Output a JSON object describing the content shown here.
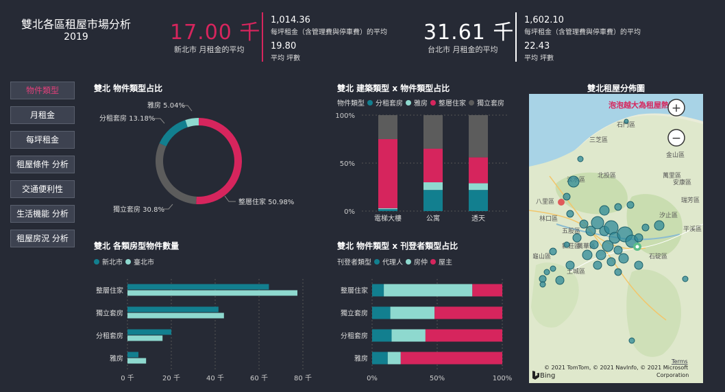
{
  "header": {
    "title": "雙北各區租屋市場分析",
    "year": "2019"
  },
  "kpis": {
    "ntpc": {
      "big": "17.00 千",
      "big_label": "新北市  月租金的平均",
      "v1": "1,014.36",
      "l1": "每坪租金（含管理費與停車費）的平均",
      "v2": "19.80",
      "l2": "平均 坪數"
    },
    "tpe": {
      "big": "31.61 千",
      "big_label": "台北市  月租金的平均",
      "v1": "1,602.10",
      "l1": "每坪租金（含管理費與停車費）的平均",
      "v2": "22.43",
      "l2": "平均 坪數"
    }
  },
  "colors": {
    "accent": "#d6255d",
    "teal": "#127f8f",
    "aqua": "#8ed9cf",
    "gray": "#5c5c5c",
    "pink": "#d6255d"
  },
  "nav": [
    {
      "label": "物件類型",
      "active": true
    },
    {
      "label": "月租金",
      "active": false
    },
    {
      "label": "每坪租金",
      "active": false
    },
    {
      "label": "租屋條件 分析",
      "active": false
    },
    {
      "label": "交通便利性",
      "active": false
    },
    {
      "label": "生活機能 分析",
      "active": false
    },
    {
      "label": "租屋房況 分析",
      "active": false
    }
  ],
  "chart_data": [
    {
      "type": "pie",
      "title": "雙北 物件類型占比",
      "categories": [
        "整層住家",
        "獨立套房",
        "分租套房",
        "雅房"
      ],
      "values": [
        50.98,
        30.8,
        13.18,
        5.04
      ],
      "labels": [
        "整層住家 50.98%",
        "獨立套房 30.8%",
        "分租套房 13.18%",
        "雅房 5.04%"
      ]
    },
    {
      "type": "bar",
      "title": "雙北 建築類型 x 物件類型占比",
      "legend_title": "物件類型",
      "categories": [
        "電梯大樓",
        "公寓",
        "透天"
      ],
      "series": [
        {
          "name": "分租套房",
          "values": [
            2,
            22,
            22
          ]
        },
        {
          "name": "雅房",
          "values": [
            1,
            8,
            7
          ]
        },
        {
          "name": "整層住家",
          "values": [
            72,
            35,
            27
          ]
        },
        {
          "name": "獨立套房",
          "values": [
            25,
            35,
            44
          ]
        }
      ],
      "ylim": [
        0,
        100
      ],
      "yticks": [
        "0%",
        "50%",
        "100%"
      ],
      "legend_position": "top-left"
    },
    {
      "type": "bar",
      "title": "雙北 各類房型物件數量",
      "categories": [
        "整層住家",
        "獨立套房",
        "分租套房",
        "雅房"
      ],
      "series": [
        {
          "name": "新北市",
          "values": [
            64.5,
            41.5,
            20,
            5
          ]
        },
        {
          "name": "臺北市",
          "values": [
            77.5,
            44,
            16,
            8.5
          ]
        }
      ],
      "xlim": [
        0,
        80
      ],
      "xticks": [
        "0 千",
        "20 千",
        "40 千",
        "60 千",
        "80 千"
      ],
      "legend_position": "top-left"
    },
    {
      "type": "bar",
      "title": "雙北 物件類型 x 刊登者類型占比",
      "legend_title": "刊登者類型",
      "categories": [
        "整層住家",
        "獨立套房",
        "分租套房",
        "雅房"
      ],
      "series": [
        {
          "name": "代理人",
          "values": [
            9,
            14,
            15,
            12
          ]
        },
        {
          "name": "房仲",
          "values": [
            68,
            34,
            26,
            10
          ]
        },
        {
          "name": "屋主",
          "values": [
            23,
            52,
            59,
            78
          ]
        }
      ],
      "xlim": [
        0,
        100
      ],
      "xticks": [
        "0%",
        "50%",
        "100%"
      ],
      "legend_position": "top-left"
    }
  ],
  "map": {
    "title": "雙北租屋分佈圖",
    "annotation": "泡泡越大為租屋熱區",
    "zoom_in": "+",
    "zoom_out": "−",
    "copyright": "© 2021 TomTom, © 2021 NavInfo, © 2021 Microsoft Corporation",
    "terms": "Terms",
    "bing": "Bing",
    "place_labels": [
      "石門區",
      "三芝區",
      "淡水區",
      "金山區",
      "萬里區",
      "汐止區",
      "林口區",
      "五股區",
      "新莊區",
      "龜山區",
      "土城區",
      "石碇區",
      "八里區",
      "北投區",
      "瑞芳區",
      "安康區",
      "平溪區",
      "萬華區"
    ]
  }
}
